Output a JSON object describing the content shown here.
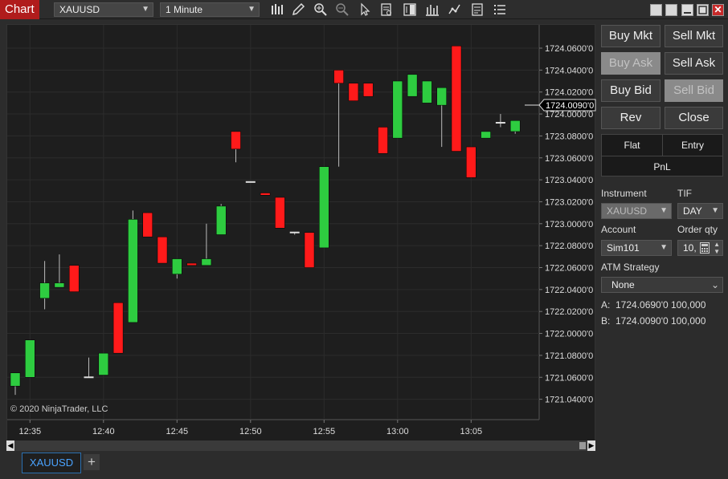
{
  "window": {
    "title": "Chart"
  },
  "toolbar": {
    "instrument": "XAUUSD",
    "interval": "1 Minute",
    "icons": [
      "bars-type-icon",
      "draw-pencil-icon",
      "zoom-in-icon",
      "zoom-out-icon",
      "pointer-icon",
      "data-box-icon",
      "chart-trader-icon",
      "indicators-icon",
      "strategies-icon",
      "properties-icon",
      "list-icon"
    ]
  },
  "colors": {
    "up": "#2ecc40",
    "down": "#ff1a1a",
    "background": "#1e1e1e",
    "brand_tab": "#b01c1c"
  },
  "copyright": "© 2020 NinjaTrader, LLC",
  "last_price_label": "1724.0090'0",
  "chart_data": {
    "type": "candlestick",
    "x_tick_labels": [
      "12:35",
      "12:40",
      "12:45",
      "12:50",
      "12:55",
      "13:00",
      "13:05"
    ],
    "y_tick_labels": [
      "1724.0600'0",
      "1724.0400'0",
      "1724.0200'0",
      "1724.0000'0",
      "1723.0800'0",
      "1723.0600'0",
      "1723.0400'0",
      "1723.0200'0",
      "1723.0000'0",
      "1722.0800'0",
      "1722.0600'0",
      "1722.0400'0",
      "1722.0200'0",
      "1722.0000'0",
      "1721.0800'0",
      "1721.0600'0",
      "1721.0400'0"
    ],
    "candles": [
      {
        "time": "12:34",
        "open": 1721.052,
        "high": 1721.062,
        "low": 1721.044,
        "close": 1721.064
      },
      {
        "time": "12:35",
        "open": 1721.06,
        "high": 1721.09,
        "low": 1721.06,
        "close": 1721.094
      },
      {
        "time": "12:36",
        "open": 1722.032,
        "high": 1722.066,
        "low": 1722.022,
        "close": 1722.046
      },
      {
        "time": "12:37",
        "open": 1722.042,
        "high": 1722.072,
        "low": 1722.042,
        "close": 1722.046
      },
      {
        "time": "12:38",
        "open": 1722.062,
        "high": 1722.062,
        "low": 1722.038,
        "close": 1722.038
      },
      {
        "time": "12:39",
        "open": 1721.06,
        "high": 1721.078,
        "low": 1721.06,
        "close": 1721.06
      },
      {
        "time": "12:40",
        "open": 1721.062,
        "high": 1721.082,
        "low": 1721.062,
        "close": 1721.082
      },
      {
        "time": "12:41",
        "open": 1722.028,
        "high": 1722.028,
        "low": 1721.082,
        "close": 1721.082
      },
      {
        "time": "12:42",
        "open": 1722.01,
        "high": 1723.012,
        "low": 1722.01,
        "close": 1723.004
      },
      {
        "time": "12:43",
        "open": 1723.01,
        "high": 1723.01,
        "low": 1722.088,
        "close": 1722.088
      },
      {
        "time": "12:44",
        "open": 1722.088,
        "high": 1722.088,
        "low": 1722.064,
        "close": 1722.064
      },
      {
        "time": "12:45",
        "open": 1722.054,
        "high": 1722.068,
        "low": 1722.05,
        "close": 1722.068
      },
      {
        "time": "12:46",
        "open": 1722.064,
        "high": 1722.064,
        "low": 1722.062,
        "close": 1722.062
      },
      {
        "time": "12:47",
        "open": 1722.062,
        "high": 1723.0,
        "low": 1722.062,
        "close": 1722.068
      },
      {
        "time": "12:48",
        "open": 1722.09,
        "high": 1723.018,
        "low": 1722.09,
        "close": 1723.016
      },
      {
        "time": "12:49",
        "open": 1723.084,
        "high": 1723.084,
        "low": 1723.056,
        "close": 1723.068
      },
      {
        "time": "12:50",
        "open": 1723.038,
        "high": 1723.038,
        "low": 1723.038,
        "close": 1723.038
      },
      {
        "time": "12:51",
        "open": 1723.028,
        "high": 1723.028,
        "low": 1723.026,
        "close": 1723.026
      },
      {
        "time": "12:52",
        "open": 1723.024,
        "high": 1723.024,
        "low": 1722.096,
        "close": 1722.096
      },
      {
        "time": "12:53",
        "open": 1722.092,
        "high": 1722.092,
        "low": 1722.09,
        "close": 1722.092
      },
      {
        "time": "12:54",
        "open": 1722.092,
        "high": 1722.092,
        "low": 1722.06,
        "close": 1722.06
      },
      {
        "time": "12:55",
        "open": 1722.078,
        "high": 1723.052,
        "low": 1722.078,
        "close": 1723.052
      },
      {
        "time": "12:56",
        "open": 1724.04,
        "high": 1724.04,
        "low": 1723.052,
        "close": 1724.028
      },
      {
        "time": "12:57",
        "open": 1724.028,
        "high": 1724.028,
        "low": 1724.012,
        "close": 1724.012
      },
      {
        "time": "12:58",
        "open": 1724.028,
        "high": 1724.028,
        "low": 1724.016,
        "close": 1724.016
      },
      {
        "time": "12:59",
        "open": 1723.088,
        "high": 1723.088,
        "low": 1723.064,
        "close": 1723.064
      },
      {
        "time": "13:00",
        "open": 1723.078,
        "high": 1724.03,
        "low": 1723.078,
        "close": 1724.03
      },
      {
        "time": "13:01",
        "open": 1724.016,
        "high": 1724.036,
        "low": 1724.016,
        "close": 1724.036
      },
      {
        "time": "13:02",
        "open": 1724.01,
        "high": 1724.03,
        "low": 1724.01,
        "close": 1724.03
      },
      {
        "time": "13:03",
        "open": 1724.008,
        "high": 1724.024,
        "low": 1723.07,
        "close": 1724.024
      },
      {
        "time": "13:04",
        "open": 1724.062,
        "high": 1724.062,
        "low": 1723.066,
        "close": 1723.066
      },
      {
        "time": "13:05",
        "open": 1723.07,
        "high": 1723.07,
        "low": 1723.042,
        "close": 1723.042
      },
      {
        "time": "13:06",
        "open": 1723.078,
        "high": 1723.084,
        "low": 1723.078,
        "close": 1723.084
      },
      {
        "time": "13:07",
        "open": 1723.092,
        "high": 1724.0,
        "low": 1723.088,
        "close": 1723.092
      },
      {
        "time": "13:08",
        "open": 1723.084,
        "high": 1723.094,
        "low": 1723.082,
        "close": 1723.094
      }
    ]
  },
  "bottom_tabs": [
    {
      "label": "XAUUSD"
    }
  ],
  "trade_panel": {
    "buy_mkt": "Buy Mkt",
    "sell_mkt": "Sell Mkt",
    "buy_ask": "Buy Ask",
    "sell_ask": "Sell Ask",
    "buy_bid": "Buy Bid",
    "sell_bid": "Sell Bid",
    "rev": "Rev",
    "close": "Close",
    "flat": "Flat",
    "entry": "Entry",
    "pnl": "PnL",
    "instrument_label": "Instrument",
    "instrument_value": "XAUUSD",
    "tif_label": "TIF",
    "tif_value": "DAY",
    "account_label": "Account",
    "account_value": "Sim101",
    "order_qty_label": "Order qty",
    "order_qty_value": "10,",
    "atm_label": "ATM Strategy",
    "atm_value": "None",
    "ask_prefix": "A:",
    "ask_price": "1724.0690'0",
    "ask_size": "100,000",
    "bid_prefix": "B:",
    "bid_price": "1724.0090'0",
    "bid_size": "100,000"
  }
}
